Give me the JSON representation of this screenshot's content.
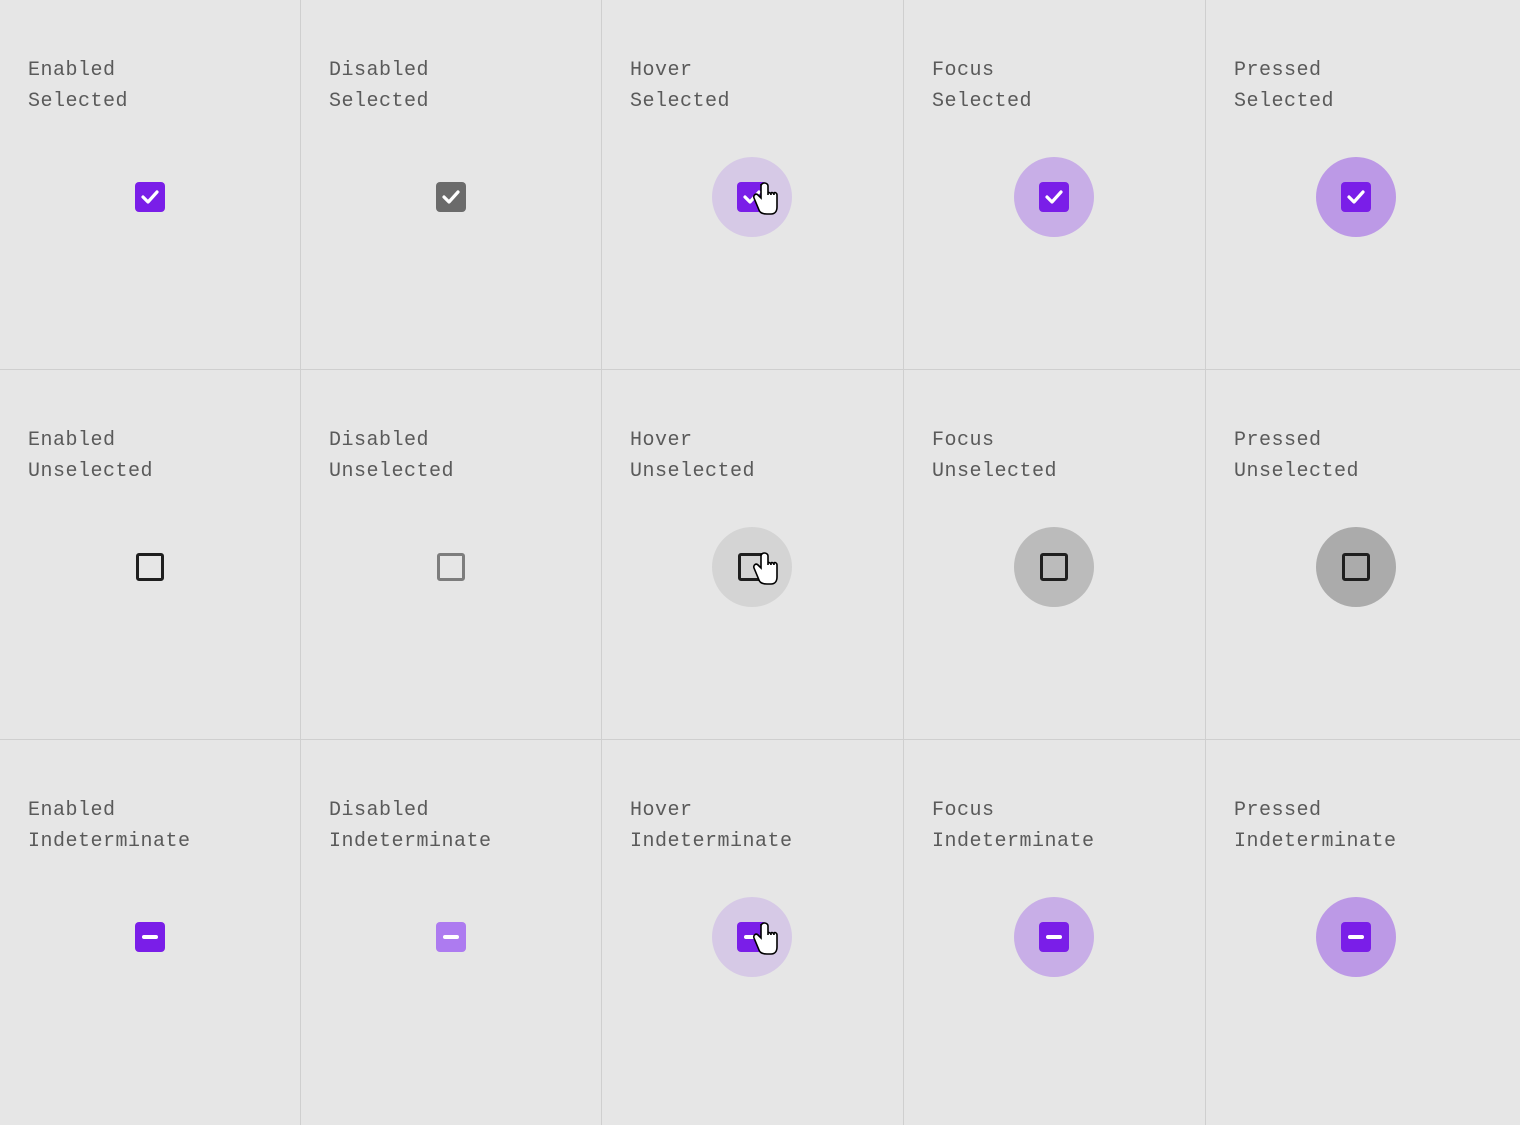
{
  "colors": {
    "accent": "#7A1EE8",
    "accent_disabled": "#ad7bf0",
    "grey_fill": "#6b6b6b",
    "outline": "#1f1f1f",
    "outline_disabled": "#7d7d7d"
  },
  "states": [
    {
      "id": "enabled",
      "label": "Enabled"
    },
    {
      "id": "disabled",
      "label": "Disabled"
    },
    {
      "id": "hover",
      "label": "Hover"
    },
    {
      "id": "focus",
      "label": "Focus"
    },
    {
      "id": "pressed",
      "label": "Pressed"
    }
  ],
  "variants": [
    {
      "id": "selected",
      "label": "Selected"
    },
    {
      "id": "unselected",
      "label": "Unselected"
    },
    {
      "id": "indeterminate",
      "label": "Indeterminate"
    }
  ],
  "cells": {
    "r0c0": {
      "line1": "Enabled",
      "line2": "Selected"
    },
    "r0c1": {
      "line1": "Disabled",
      "line2": "Selected"
    },
    "r0c2": {
      "line1": "Hover",
      "line2": "Selected"
    },
    "r0c3": {
      "line1": "Focus",
      "line2": "Selected"
    },
    "r0c4": {
      "line1": "Pressed",
      "line2": "Selected"
    },
    "r1c0": {
      "line1": "Enabled",
      "line2": "Unselected"
    },
    "r1c1": {
      "line1": "Disabled",
      "line2": "Unselected"
    },
    "r1c2": {
      "line1": "Hover",
      "line2": "Unselected"
    },
    "r1c3": {
      "line1": "Focus",
      "line2": "Unselected"
    },
    "r1c4": {
      "line1": "Pressed",
      "line2": "Unselected"
    },
    "r2c0": {
      "line1": "Enabled",
      "line2": "Indeterminate"
    },
    "r2c1": {
      "line1": "Disabled",
      "line2": "Indeterminate"
    },
    "r2c2": {
      "line1": "Hover",
      "line2": "Indeterminate"
    },
    "r2c3": {
      "line1": "Focus",
      "line2": "Indeterminate"
    },
    "r2c4": {
      "line1": "Pressed",
      "line2": "Indeterminate"
    }
  }
}
